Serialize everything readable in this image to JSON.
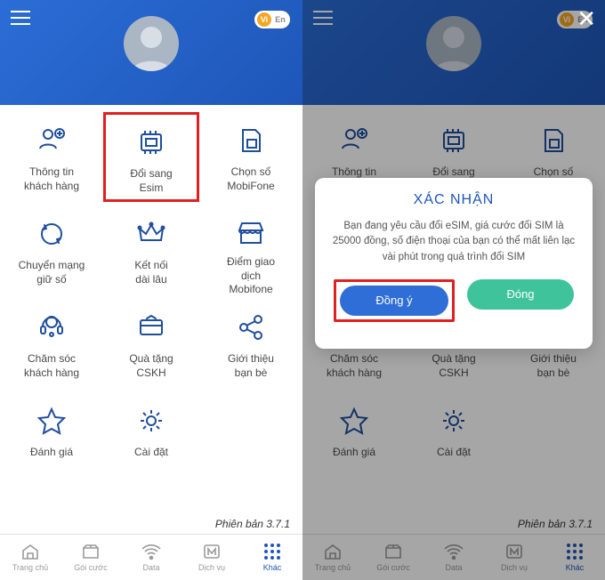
{
  "lang": {
    "active": "Vi",
    "inactive": "En"
  },
  "menu": [
    {
      "name": "info",
      "label": "Thông tin\nkhách hàng"
    },
    {
      "name": "esim",
      "label": "Đổi sang\nEsim"
    },
    {
      "name": "number",
      "label": "Chọn số\nMobiFone"
    },
    {
      "name": "port",
      "label": "Chuyển mạng\ngiữ số"
    },
    {
      "name": "connect",
      "label": "Kết nối\ndài lâu"
    },
    {
      "name": "store",
      "label": "Điểm giao\ndịch\nMobifone"
    },
    {
      "name": "care",
      "label": "Chăm sóc\nkhách hàng"
    },
    {
      "name": "gift",
      "label": "Quà tặng\nCSKH"
    },
    {
      "name": "refer",
      "label": "Giới thiệu\nbạn bè"
    },
    {
      "name": "rate",
      "label": "Đánh giá"
    },
    {
      "name": "settings",
      "label": "Cài đặt"
    }
  ],
  "version": "Phiên bản 3.7.1",
  "tabs": [
    {
      "name": "home",
      "label": "Trang chủ"
    },
    {
      "name": "plan",
      "label": "Gói cước"
    },
    {
      "name": "data",
      "label": "Data"
    },
    {
      "name": "service",
      "label": "Dịch vụ"
    },
    {
      "name": "other",
      "label": "Khác"
    }
  ],
  "modal": {
    "title": "XÁC NHẬN",
    "body": "Bạn đang yêu cầu đổi eSIM, giá cước đổi SIM là 25000 đồng, số điện thoại của bạn có thể mất liên lạc vài phút trong quá trình đổi SIM",
    "confirm": "Đồng ý",
    "cancel": "Đóng"
  }
}
